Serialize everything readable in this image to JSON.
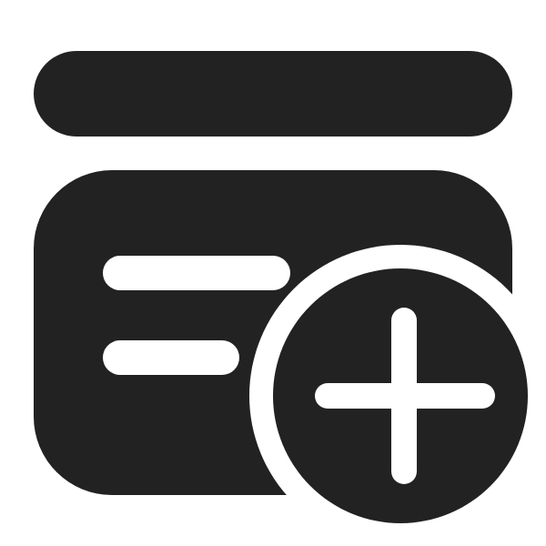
{
  "icon": {
    "name": "archive-add-icon",
    "parts": [
      "lid-bar",
      "box-body",
      "text-line-long",
      "text-line-short",
      "add-badge",
      "plus-sign"
    ]
  },
  "colors": {
    "foreground": "#222222",
    "background": "#ffffff"
  }
}
